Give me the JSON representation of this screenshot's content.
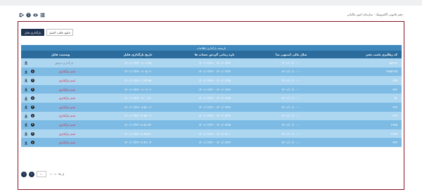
{
  "app": {
    "title": "دفتر قانونی الکترونیک - سازمان امور مالیاتی"
  },
  "toolbar": {
    "icons": [
      "exit-icon",
      "help-icon",
      "eye-icon",
      "menu-grid-icon"
    ]
  },
  "actions": {
    "upload_label": "بارگذاری فایل",
    "download_template_label": "دانلود قالب اکسل"
  },
  "table": {
    "caption": "تاریخچه بارگذاری اطلاعات",
    "columns": {
      "registration_code": "کد رهگیری پلمب دفتر",
      "fiscal_year": "سال مالی (منتهی به)",
      "period": "بازه زمانی گردش حساب ها",
      "upload_date": "تاریخ بارگذاری فایل",
      "status": "وضعیت فایل"
    },
    "rows": [
      {
        "code": "۵۶۳۹۳",
        "year": "۱۴۰۱/۱۰/۱ ۰:۰۰",
        "period": "۱۴۰۱/۰۲/۲۳ - ۱۴۰۱/۰۲/۲۳",
        "date": "۱۴۰۱/۰۲/۲۴ ۰۹:۰۶:۴۵",
        "status": "بارگذاری موفق",
        "ok": true
      },
      {
        "code": "۴۲۵۲۲۲۵",
        "year": "۱۴۰۱/۱۰/۱ ۰:۰۰",
        "period": "۱۴۰۱/۰۲/۲۳ - ۱۴۰۱/۰۲/۲۳",
        "date": "۱۴۰۱/۰۲/۲۳ ۰۹:۰۵:۰۲",
        "status": "عدم بارگذاری",
        "ok": false
      },
      {
        "code": "۳۲۵",
        "year": "۱۴۰۱/۱۰/۱ ۰:۰۰",
        "period": "۱۴۰۱/۰۲/۲۳ - ۱۴۰۱/۰۲/۲۵",
        "date": "۱۴۰۱/۰۲/۲۳ ۱۱:۲۴:۳۵",
        "status": "عدم بارگذاری",
        "ok": false
      },
      {
        "code": "۳۲۲",
        "year": "۱۴۰۱/۱۰/۱ ۰:۰۰",
        "period": "۱۴۰۱/۰۲/۲۳ - ۱۴۰۱/۰۲/۲۳",
        "date": "۱۴۰۱/۰۲/۲۳ ۰۹:۰۳:۰۲",
        "status": "عدم بارگذاری",
        "ok": false
      },
      {
        "code": "۵۶",
        "year": "۱۴۰۱/۱۰/۱ ۰:۰۰",
        "period": "۱۴۰۱/۰۲/۲۳ - ۱۴۰۱/۰۲/۲۵",
        "date": "۱۴۰۱/۰۲/۲۳ ۰۹:۰۰:۴۱",
        "status": "عدم بارگذاری",
        "ok": false
      },
      {
        "code": "۳۲۳",
        "year": "۱۴۰۱/۱۰/۱ ۰:۰۰",
        "period": "۱۴۰۱/۰۲/۲۳ - ۱۴۰۱/۰۲/۲۳",
        "date": "۱۴۰۱/۰۲/۲۳ ۰۸:۵۱:۰۳",
        "status": "عدم بارگذاری",
        "ok": false
      },
      {
        "code": "۳۲۳",
        "year": "۱۴۰۱/۱۰/۱ ۰:۰۰",
        "period": "۱۴۰۱/۰۲/۲۳ - ۱۴۰۱/۰۲/۲۳",
        "date": "۱۴۰۱/۰۲/۲۲ ۱۶:۵۳:۰۶",
        "status": "عدم بارگذاری",
        "ok": false
      },
      {
        "code": "۲۳۴۵",
        "year": "۱۴۰۱/۱۰/۱ ۰:۰۰",
        "period": "۱۴۰۱/۰۲/۲۳ - ۱۴۰۱/۰۲/۲۵",
        "date": "۱۴۰۱/۰۲/۲۲ ۱۶:۵۱:۴۲",
        "status": "عدم بارگذاری",
        "ok": false
      },
      {
        "code": "۲۳۳۴",
        "year": "۱۴۰۱/۱۰/۱ ۰:۰۰",
        "period": "۱۴۰۱/۰۲/۲۲ - ۱۴۰۱/۰۲/۰۱",
        "date": "۱۴۰۱/۰۲/۲۲ ۱۶:۴۸:۴۱",
        "status": "عدم بارگذاری",
        "ok": false
      },
      {
        "code": "۳۲۴",
        "year": "۱۴۰۱/۱۰/۱ ۰:۰۰",
        "period": "۱۴۰۱/۰۲/۲۲ - ۱۴۰۱/۰۲/۲۲",
        "date": "۱۴۰۱/۰۲/۲۲ ۱۶:۴۶:۰۴",
        "status": "عدم بارگذاری",
        "ok": false
      }
    ]
  },
  "pagination": {
    "page_size": "۱۰",
    "info": "۱ - ۱۰ از ۹۸"
  },
  "colors": {
    "panel_border": "#8a1224",
    "header": "#2c6c9c",
    "caption": "#3e88bd",
    "row_light": "#add6f1",
    "row_dark": "#7dbbe4",
    "status_fail": "#e0182f",
    "button_primary": "#1e3350"
  }
}
